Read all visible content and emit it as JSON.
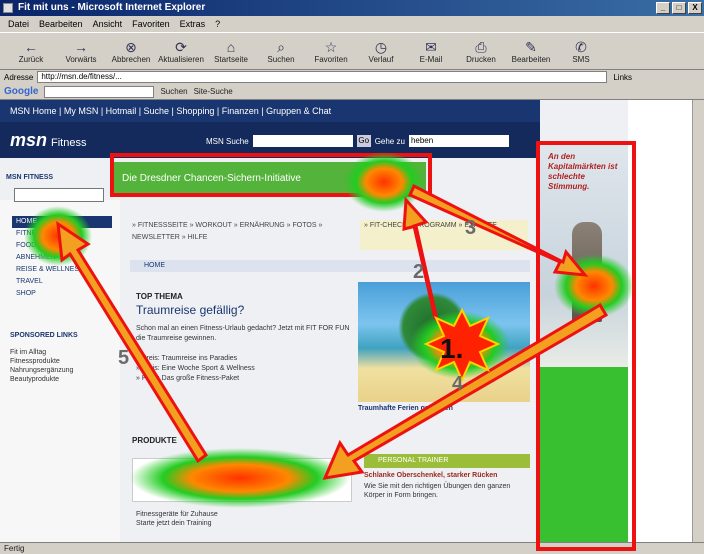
{
  "window": {
    "title": "Fit mit uns - Microsoft Internet Explorer",
    "controls": [
      "_",
      "□",
      "X"
    ]
  },
  "menu": [
    "Datei",
    "Bearbeiten",
    "Ansicht",
    "Favoriten",
    "Extras",
    "?"
  ],
  "toolbar": [
    "Zurück",
    "Vorwärts",
    "Abbrechen",
    "Aktualisieren",
    "Startseite",
    "Suchen",
    "Favoriten",
    "Verlauf",
    "E-Mail",
    "Drucken",
    "Bearbeiten",
    "SMS"
  ],
  "address": {
    "label": "Adresse",
    "url": "http://msn.de/fitness/...",
    "links": "Links"
  },
  "google": {
    "logo": "Google",
    "search_label": "Suchen",
    "site_search": "Site-Suche"
  },
  "msn": {
    "nav": "MSN Home | My MSN | Hotmail | Suche | Shopping | Finanzen | Gruppen & Chat",
    "logo": "msn",
    "logo_sub": "Fitness",
    "search_label": "MSN Suche",
    "go_label": "Go",
    "jump_label": "Gehe zu",
    "jump_value": "heben"
  },
  "banner": {
    "text": "Die Dresdner Chancen-Sichern-Initiative"
  },
  "leftcol": {
    "search_head": "MSN FITNESS",
    "nav": [
      "HOME",
      "FITNESS",
      "FOOD",
      "ABNEHMEN",
      "REISE & WELLNESS",
      "TRAVEL",
      "SHOP"
    ],
    "active_index": 0,
    "sub_head": "SPONSORED LINKS",
    "sub_text": "Fit im Alltag\nFitnessprodukte\nNahrungsergänzung\nBeautyprodukte"
  },
  "subnav": "» FITNESSSEITE  » WORKOUT  » ERNÄHRUNG  » FOTOS  » NEWSLETTER  » HILFE",
  "subnav2": "» FIT-CHECK  » PROGRAMM  » EXPERTE",
  "homebar": "HOME",
  "topthema": {
    "label": "TOP THEMA",
    "title": "Traumreise gefällig?",
    "body": "Schon mal an einen Fitness-Urlaub gedacht? Jetzt mit FIT FOR FUN die Traumreise gewinnen.",
    "list": "» Preis: Traumreise ins Paradies\n» Preis: Eine Woche Sport & Wellness\n» Preis: Das große Fitness-Paket"
  },
  "beach_caption": "Traumhafte Ferien gewinnen",
  "produkte": {
    "label": "PRODUKTE",
    "text": "Fitnessgeräte für Zuhause\nStarte jetzt dein Training"
  },
  "personal": {
    "head": "PERSONAL TRAINER",
    "title": "Schlanke Oberschenkel, starker Rücken",
    "body": "Wie Sie mit den richtigen Übungen den ganzen Körper in Form bringen."
  },
  "ad": {
    "text": "An den Kapitalmärkten ist schlechte Stimmung."
  },
  "status": "Fertig",
  "overlay": {
    "labels": [
      "1.",
      "2",
      "3",
      "4",
      "5"
    ],
    "colors": {
      "box": "#ee1111",
      "arrow_fill": "#f3a020",
      "arrow_stroke": "#ee1111",
      "heat_outer": "#22cc22",
      "heat_inner": "#ff3300",
      "star": "#ff2200"
    }
  }
}
